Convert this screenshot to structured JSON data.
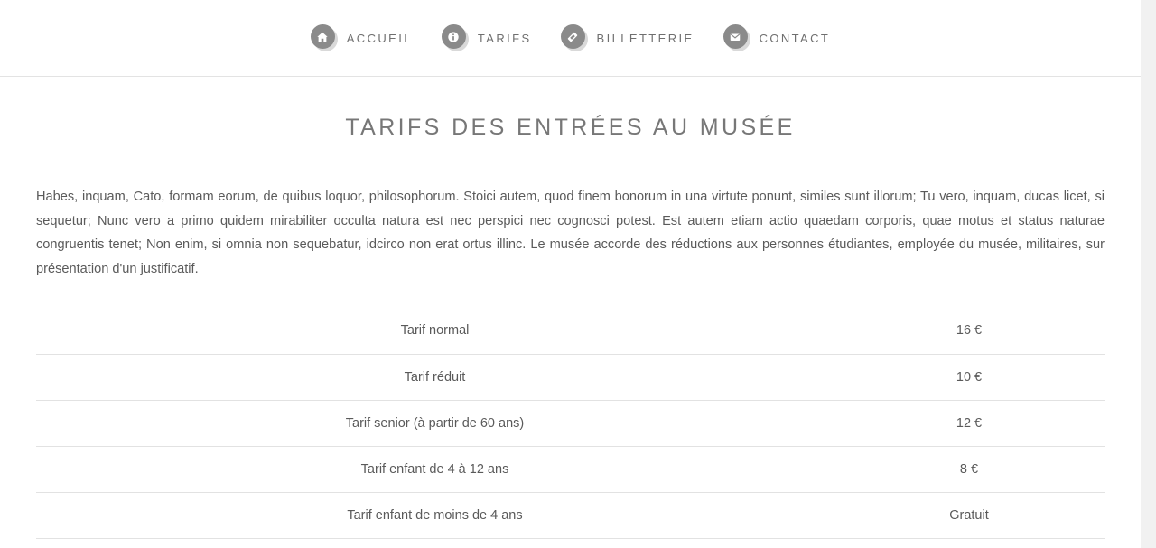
{
  "nav": {
    "items": [
      {
        "label": "ACCUEIL",
        "icon": "home-icon"
      },
      {
        "label": "TARIFS",
        "icon": "info-icon"
      },
      {
        "label": "BILLETTERIE",
        "icon": "ticket-icon"
      },
      {
        "label": "CONTACT",
        "icon": "envelope-icon"
      }
    ]
  },
  "main": {
    "title": "TARIFS DES ENTRÉES AU MUSÉE",
    "intro": "Habes, inquam, Cato, formam eorum, de quibus loquor, philosophorum. Stoici autem, quod finem bonorum in una virtute ponunt, similes sunt illorum; Tu vero, inquam, ducas licet, si sequetur; Nunc vero a primo quidem mirabiliter occulta natura est nec perspici nec cognosci potest. Est autem etiam actio quaedam corporis, quae motus et status naturae congruentis tenet; Non enim, si omnia non sequebatur, idcirco non erat ortus illinc. Le musée accorde des réductions aux personnes étudiantes, employée du musée, militaires, sur présentation d'un justificatif.",
    "tarifs": [
      {
        "label": "Tarif normal",
        "price": "16 €"
      },
      {
        "label": "Tarif réduit",
        "price": "10 €"
      },
      {
        "label": "Tarif senior (à partir de 60 ans)",
        "price": "12 €"
      },
      {
        "label": "Tarif enfant de 4 à 12 ans",
        "price": "8 €"
      },
      {
        "label": "Tarif enfant de moins de 4 ans",
        "price": "Gratuit"
      }
    ]
  },
  "colors": {
    "icon_disc": "#8a8a8a",
    "nav_text": "#6f6f6f",
    "title_text": "#777777",
    "body_text": "#5a5a5a",
    "divider": "#e2e2e2"
  }
}
